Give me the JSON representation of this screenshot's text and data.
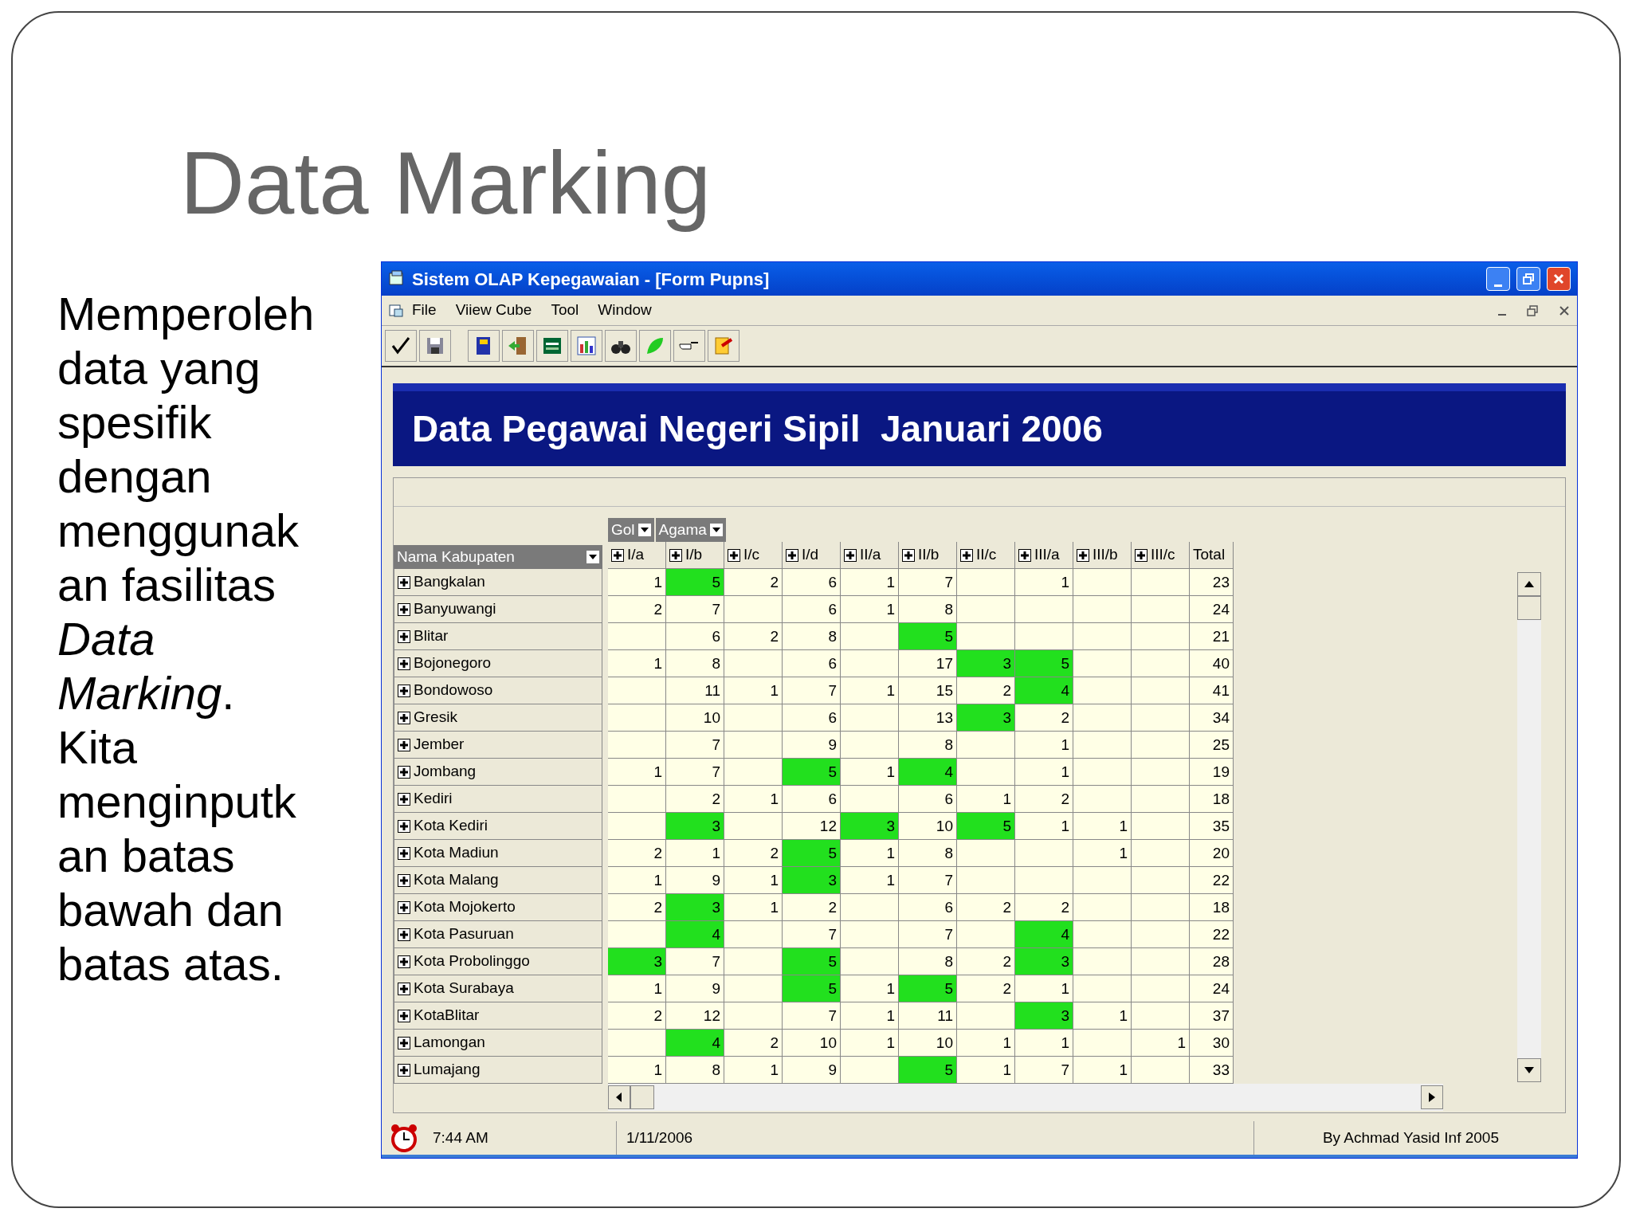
{
  "slide": {
    "title": "Data Marking",
    "body": "Memperoleh data yang spesifik dengan menggunakan fasilitas *Data Marking*. Kita menginputkan batas bawah dan batas atas."
  },
  "window": {
    "title": "Sistem OLAP Kepegawaian - [Form Pupns]"
  },
  "menu": [
    "File",
    "Viiew Cube",
    "Tool",
    "Window"
  ],
  "toolbar": [
    {
      "kind": "check"
    },
    {
      "kind": "save"
    },
    {
      "kind": "book"
    },
    {
      "kind": "door"
    },
    {
      "kind": "sheet"
    },
    {
      "kind": "chart"
    },
    {
      "kind": "binoculars"
    },
    {
      "kind": "leaf"
    },
    {
      "kind": "hand"
    },
    {
      "kind": "exit"
    }
  ],
  "report_title": "Data Pegawai Negeri Sipil  Januari 2006",
  "pivot": {
    "column_fields": [
      "Gol",
      "Agama"
    ],
    "row_field": "Nama Kabupaten",
    "columns": [
      "I/a",
      "I/b",
      "I/c",
      "I/d",
      "II/a",
      "II/b",
      "II/c",
      "III/a",
      "III/b",
      "III/c"
    ],
    "total_label": "Total",
    "rows": [
      {
        "name": "Bangkalan",
        "cells": [
          {
            "value": "1",
            "marked": false
          },
          {
            "value": "5",
            "marked": true
          },
          {
            "value": "2",
            "marked": false
          },
          {
            "value": "6",
            "marked": false
          },
          {
            "value": "1",
            "marked": false
          },
          {
            "value": "7",
            "marked": false
          },
          {
            "marked": false
          },
          {
            "value": "1",
            "marked": false
          },
          {
            "marked": false
          },
          {
            "marked": false
          }
        ],
        "total": "23"
      },
      {
        "name": "Banyuwangi",
        "cells": [
          {
            "value": "2",
            "marked": false
          },
          {
            "value": "7",
            "marked": false
          },
          {
            "marked": false
          },
          {
            "value": "6",
            "marked": false
          },
          {
            "value": "1",
            "marked": false
          },
          {
            "value": "8",
            "marked": false
          },
          {
            "marked": false
          },
          {
            "marked": false
          },
          {
            "marked": false
          },
          {
            "marked": false
          }
        ],
        "total": "24"
      },
      {
        "name": "Blitar",
        "cells": [
          {
            "marked": false
          },
          {
            "value": "6",
            "marked": false
          },
          {
            "value": "2",
            "marked": false
          },
          {
            "value": "8",
            "marked": false
          },
          {
            "marked": false
          },
          {
            "value": "5",
            "marked": true
          },
          {
            "marked": false
          },
          {
            "marked": false
          },
          {
            "marked": false
          },
          {
            "marked": false
          }
        ],
        "total": "21"
      },
      {
        "name": "Bojonegoro",
        "cells": [
          {
            "value": "1",
            "marked": false
          },
          {
            "value": "8",
            "marked": false
          },
          {
            "marked": false
          },
          {
            "value": "6",
            "marked": false
          },
          {
            "marked": false
          },
          {
            "value": "17",
            "marked": false
          },
          {
            "value": "3",
            "marked": true
          },
          {
            "value": "5",
            "marked": true
          },
          {
            "marked": false
          },
          {
            "marked": false
          }
        ],
        "total": "40"
      },
      {
        "name": "Bondowoso",
        "cells": [
          {
            "marked": false
          },
          {
            "value": "11",
            "marked": false
          },
          {
            "value": "1",
            "marked": false
          },
          {
            "value": "7",
            "marked": false
          },
          {
            "value": "1",
            "marked": false
          },
          {
            "value": "15",
            "marked": false
          },
          {
            "value": "2",
            "marked": false
          },
          {
            "value": "4",
            "marked": true
          },
          {
            "marked": false
          },
          {
            "marked": false
          }
        ],
        "total": "41"
      },
      {
        "name": "Gresik",
        "cells": [
          {
            "marked": false
          },
          {
            "value": "10",
            "marked": false
          },
          {
            "marked": false
          },
          {
            "value": "6",
            "marked": false
          },
          {
            "marked": false
          },
          {
            "value": "13",
            "marked": false
          },
          {
            "value": "3",
            "marked": true
          },
          {
            "value": "2",
            "marked": false
          },
          {
            "marked": false
          },
          {
            "marked": false
          }
        ],
        "total": "34"
      },
      {
        "name": "Jember",
        "cells": [
          {
            "marked": false
          },
          {
            "value": "7",
            "marked": false
          },
          {
            "marked": false
          },
          {
            "value": "9",
            "marked": false
          },
          {
            "marked": false
          },
          {
            "value": "8",
            "marked": false
          },
          {
            "marked": false
          },
          {
            "value": "1",
            "marked": false
          },
          {
            "marked": false
          },
          {
            "marked": false
          }
        ],
        "total": "25"
      },
      {
        "name": "Jombang",
        "cells": [
          {
            "value": "1",
            "marked": false
          },
          {
            "value": "7",
            "marked": false
          },
          {
            "marked": false
          },
          {
            "value": "5",
            "marked": true
          },
          {
            "value": "1",
            "marked": false
          },
          {
            "value": "4",
            "marked": true
          },
          {
            "marked": false
          },
          {
            "value": "1",
            "marked": false
          },
          {
            "marked": false
          },
          {
            "marked": false
          }
        ],
        "total": "19"
      },
      {
        "name": "Kediri",
        "cells": [
          {
            "marked": false
          },
          {
            "value": "2",
            "marked": false
          },
          {
            "value": "1",
            "marked": false
          },
          {
            "value": "6",
            "marked": false
          },
          {
            "marked": false
          },
          {
            "value": "6",
            "marked": false
          },
          {
            "value": "1",
            "marked": false
          },
          {
            "value": "2",
            "marked": false
          },
          {
            "marked": false
          },
          {
            "marked": false
          }
        ],
        "total": "18"
      },
      {
        "name": "Kota Kediri",
        "cells": [
          {
            "marked": false
          },
          {
            "value": "3",
            "marked": true
          },
          {
            "marked": false
          },
          {
            "value": "12",
            "marked": false
          },
          {
            "value": "3",
            "marked": true
          },
          {
            "value": "10",
            "marked": false
          },
          {
            "value": "5",
            "marked": true
          },
          {
            "value": "1",
            "marked": false
          },
          {
            "value": "1",
            "marked": false
          },
          {
            "marked": false
          }
        ],
        "total": "35"
      },
      {
        "name": "Kota Madiun",
        "cells": [
          {
            "value": "2",
            "marked": false
          },
          {
            "value": "1",
            "marked": false
          },
          {
            "value": "2",
            "marked": false
          },
          {
            "value": "5",
            "marked": true
          },
          {
            "value": "1",
            "marked": false
          },
          {
            "value": "8",
            "marked": false
          },
          {
            "marked": false
          },
          {
            "marked": false
          },
          {
            "value": "1",
            "marked": false
          },
          {
            "marked": false
          }
        ],
        "total": "20"
      },
      {
        "name": "Kota Malang",
        "cells": [
          {
            "value": "1",
            "marked": false
          },
          {
            "value": "9",
            "marked": false
          },
          {
            "value": "1",
            "marked": false
          },
          {
            "value": "3",
            "marked": true
          },
          {
            "value": "1",
            "marked": false
          },
          {
            "value": "7",
            "marked": false
          },
          {
            "marked": false
          },
          {
            "marked": false
          },
          {
            "marked": false
          },
          {
            "marked": false
          }
        ],
        "total": "22"
      },
      {
        "name": "Kota Mojokerto",
        "cells": [
          {
            "value": "2",
            "marked": false
          },
          {
            "value": "3",
            "marked": true
          },
          {
            "value": "1",
            "marked": false
          },
          {
            "value": "2",
            "marked": false
          },
          {
            "marked": false
          },
          {
            "value": "6",
            "marked": false
          },
          {
            "value": "2",
            "marked": false
          },
          {
            "value": "2",
            "marked": false
          },
          {
            "marked": false
          },
          {
            "marked": false
          }
        ],
        "total": "18"
      },
      {
        "name": "Kota Pasuruan",
        "cells": [
          {
            "marked": false
          },
          {
            "value": "4",
            "marked": true
          },
          {
            "marked": false
          },
          {
            "value": "7",
            "marked": false
          },
          {
            "marked": false
          },
          {
            "value": "7",
            "marked": false
          },
          {
            "marked": false
          },
          {
            "value": "4",
            "marked": true
          },
          {
            "marked": false
          },
          {
            "marked": false
          }
        ],
        "total": "22"
      },
      {
        "name": "Kota Probolinggo",
        "cells": [
          {
            "value": "3",
            "marked": true
          },
          {
            "value": "7",
            "marked": false
          },
          {
            "marked": false
          },
          {
            "value": "5",
            "marked": true
          },
          {
            "marked": false
          },
          {
            "value": "8",
            "marked": false
          },
          {
            "value": "2",
            "marked": false
          },
          {
            "value": "3",
            "marked": true
          },
          {
            "marked": false
          },
          {
            "marked": false
          }
        ],
        "total": "28"
      },
      {
        "name": "Kota Surabaya",
        "cells": [
          {
            "value": "1",
            "marked": false
          },
          {
            "value": "9",
            "marked": false
          },
          {
            "marked": false
          },
          {
            "value": "5",
            "marked": true
          },
          {
            "value": "1",
            "marked": false
          },
          {
            "value": "5",
            "marked": true
          },
          {
            "value": "2",
            "marked": false
          },
          {
            "value": "1",
            "marked": false
          },
          {
            "marked": false
          },
          {
            "marked": false
          }
        ],
        "total": "24"
      },
      {
        "name": "KotaBlitar",
        "cells": [
          {
            "value": "2",
            "marked": false
          },
          {
            "value": "12",
            "marked": false
          },
          {
            "marked": false
          },
          {
            "value": "7",
            "marked": false
          },
          {
            "value": "1",
            "marked": false
          },
          {
            "value": "11",
            "marked": false
          },
          {
            "marked": false
          },
          {
            "value": "3",
            "marked": true
          },
          {
            "value": "1",
            "marked": false
          },
          {
            "marked": false
          }
        ],
        "total": "37"
      },
      {
        "name": "Lamongan",
        "cells": [
          {
            "marked": false
          },
          {
            "value": "4",
            "marked": true
          },
          {
            "value": "2",
            "marked": false
          },
          {
            "value": "10",
            "marked": false
          },
          {
            "value": "1",
            "marked": false
          },
          {
            "value": "10",
            "marked": false
          },
          {
            "value": "1",
            "marked": false
          },
          {
            "value": "1",
            "marked": false
          },
          {
            "marked": false
          },
          {
            "value": "1",
            "marked": false
          }
        ],
        "total": "30"
      },
      {
        "name": "Lumajang",
        "cells": [
          {
            "value": "1",
            "marked": false
          },
          {
            "value": "8",
            "marked": false
          },
          {
            "value": "1",
            "marked": false
          },
          {
            "value": "9",
            "marked": false
          },
          {
            "marked": false
          },
          {
            "value": "5",
            "marked": true
          },
          {
            "value": "1",
            "marked": false
          },
          {
            "value": "7",
            "marked": false
          },
          {
            "value": "1",
            "marked": false
          },
          {
            "marked": false
          }
        ],
        "total": "33"
      }
    ]
  },
  "status_bar": {
    "time": "7:44 AM",
    "date": "1/11/2006",
    "credit": "By Achmad Yasid Inf 2005"
  }
}
